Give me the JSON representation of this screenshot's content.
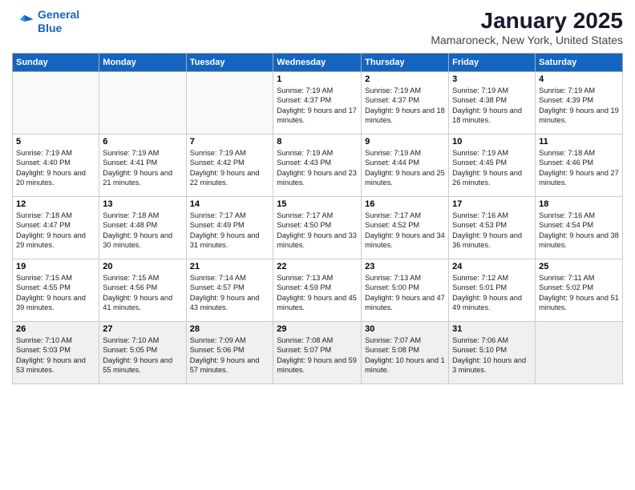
{
  "logo": {
    "line1": "General",
    "line2": "Blue"
  },
  "title": "January 2025",
  "location": "Mamaroneck, New York, United States",
  "weekdays": [
    "Sunday",
    "Monday",
    "Tuesday",
    "Wednesday",
    "Thursday",
    "Friday",
    "Saturday"
  ],
  "weeks": [
    [
      {
        "day": "",
        "info": ""
      },
      {
        "day": "",
        "info": ""
      },
      {
        "day": "",
        "info": ""
      },
      {
        "day": "1",
        "info": "Sunrise: 7:19 AM\nSunset: 4:37 PM\nDaylight: 9 hours\nand 17 minutes."
      },
      {
        "day": "2",
        "info": "Sunrise: 7:19 AM\nSunset: 4:37 PM\nDaylight: 9 hours\nand 18 minutes."
      },
      {
        "day": "3",
        "info": "Sunrise: 7:19 AM\nSunset: 4:38 PM\nDaylight: 9 hours\nand 18 minutes."
      },
      {
        "day": "4",
        "info": "Sunrise: 7:19 AM\nSunset: 4:39 PM\nDaylight: 9 hours\nand 19 minutes."
      }
    ],
    [
      {
        "day": "5",
        "info": "Sunrise: 7:19 AM\nSunset: 4:40 PM\nDaylight: 9 hours\nand 20 minutes."
      },
      {
        "day": "6",
        "info": "Sunrise: 7:19 AM\nSunset: 4:41 PM\nDaylight: 9 hours\nand 21 minutes."
      },
      {
        "day": "7",
        "info": "Sunrise: 7:19 AM\nSunset: 4:42 PM\nDaylight: 9 hours\nand 22 minutes."
      },
      {
        "day": "8",
        "info": "Sunrise: 7:19 AM\nSunset: 4:43 PM\nDaylight: 9 hours\nand 23 minutes."
      },
      {
        "day": "9",
        "info": "Sunrise: 7:19 AM\nSunset: 4:44 PM\nDaylight: 9 hours\nand 25 minutes."
      },
      {
        "day": "10",
        "info": "Sunrise: 7:19 AM\nSunset: 4:45 PM\nDaylight: 9 hours\nand 26 minutes."
      },
      {
        "day": "11",
        "info": "Sunrise: 7:18 AM\nSunset: 4:46 PM\nDaylight: 9 hours\nand 27 minutes."
      }
    ],
    [
      {
        "day": "12",
        "info": "Sunrise: 7:18 AM\nSunset: 4:47 PM\nDaylight: 9 hours\nand 29 minutes."
      },
      {
        "day": "13",
        "info": "Sunrise: 7:18 AM\nSunset: 4:48 PM\nDaylight: 9 hours\nand 30 minutes."
      },
      {
        "day": "14",
        "info": "Sunrise: 7:17 AM\nSunset: 4:49 PM\nDaylight: 9 hours\nand 31 minutes."
      },
      {
        "day": "15",
        "info": "Sunrise: 7:17 AM\nSunset: 4:50 PM\nDaylight: 9 hours\nand 33 minutes."
      },
      {
        "day": "16",
        "info": "Sunrise: 7:17 AM\nSunset: 4:52 PM\nDaylight: 9 hours\nand 34 minutes."
      },
      {
        "day": "17",
        "info": "Sunrise: 7:16 AM\nSunset: 4:53 PM\nDaylight: 9 hours\nand 36 minutes."
      },
      {
        "day": "18",
        "info": "Sunrise: 7:16 AM\nSunset: 4:54 PM\nDaylight: 9 hours\nand 38 minutes."
      }
    ],
    [
      {
        "day": "19",
        "info": "Sunrise: 7:15 AM\nSunset: 4:55 PM\nDaylight: 9 hours\nand 39 minutes."
      },
      {
        "day": "20",
        "info": "Sunrise: 7:15 AM\nSunset: 4:56 PM\nDaylight: 9 hours\nand 41 minutes."
      },
      {
        "day": "21",
        "info": "Sunrise: 7:14 AM\nSunset: 4:57 PM\nDaylight: 9 hours\nand 43 minutes."
      },
      {
        "day": "22",
        "info": "Sunrise: 7:13 AM\nSunset: 4:59 PM\nDaylight: 9 hours\nand 45 minutes."
      },
      {
        "day": "23",
        "info": "Sunrise: 7:13 AM\nSunset: 5:00 PM\nDaylight: 9 hours\nand 47 minutes."
      },
      {
        "day": "24",
        "info": "Sunrise: 7:12 AM\nSunset: 5:01 PM\nDaylight: 9 hours\nand 49 minutes."
      },
      {
        "day": "25",
        "info": "Sunrise: 7:11 AM\nSunset: 5:02 PM\nDaylight: 9 hours\nand 51 minutes."
      }
    ],
    [
      {
        "day": "26",
        "info": "Sunrise: 7:10 AM\nSunset: 5:03 PM\nDaylight: 9 hours\nand 53 minutes."
      },
      {
        "day": "27",
        "info": "Sunrise: 7:10 AM\nSunset: 5:05 PM\nDaylight: 9 hours\nand 55 minutes."
      },
      {
        "day": "28",
        "info": "Sunrise: 7:09 AM\nSunset: 5:06 PM\nDaylight: 9 hours\nand 57 minutes."
      },
      {
        "day": "29",
        "info": "Sunrise: 7:08 AM\nSunset: 5:07 PM\nDaylight: 9 hours\nand 59 minutes."
      },
      {
        "day": "30",
        "info": "Sunrise: 7:07 AM\nSunset: 5:08 PM\nDaylight: 10 hours\nand 1 minute."
      },
      {
        "day": "31",
        "info": "Sunrise: 7:06 AM\nSunset: 5:10 PM\nDaylight: 10 hours\nand 3 minutes."
      },
      {
        "day": "",
        "info": ""
      }
    ]
  ]
}
